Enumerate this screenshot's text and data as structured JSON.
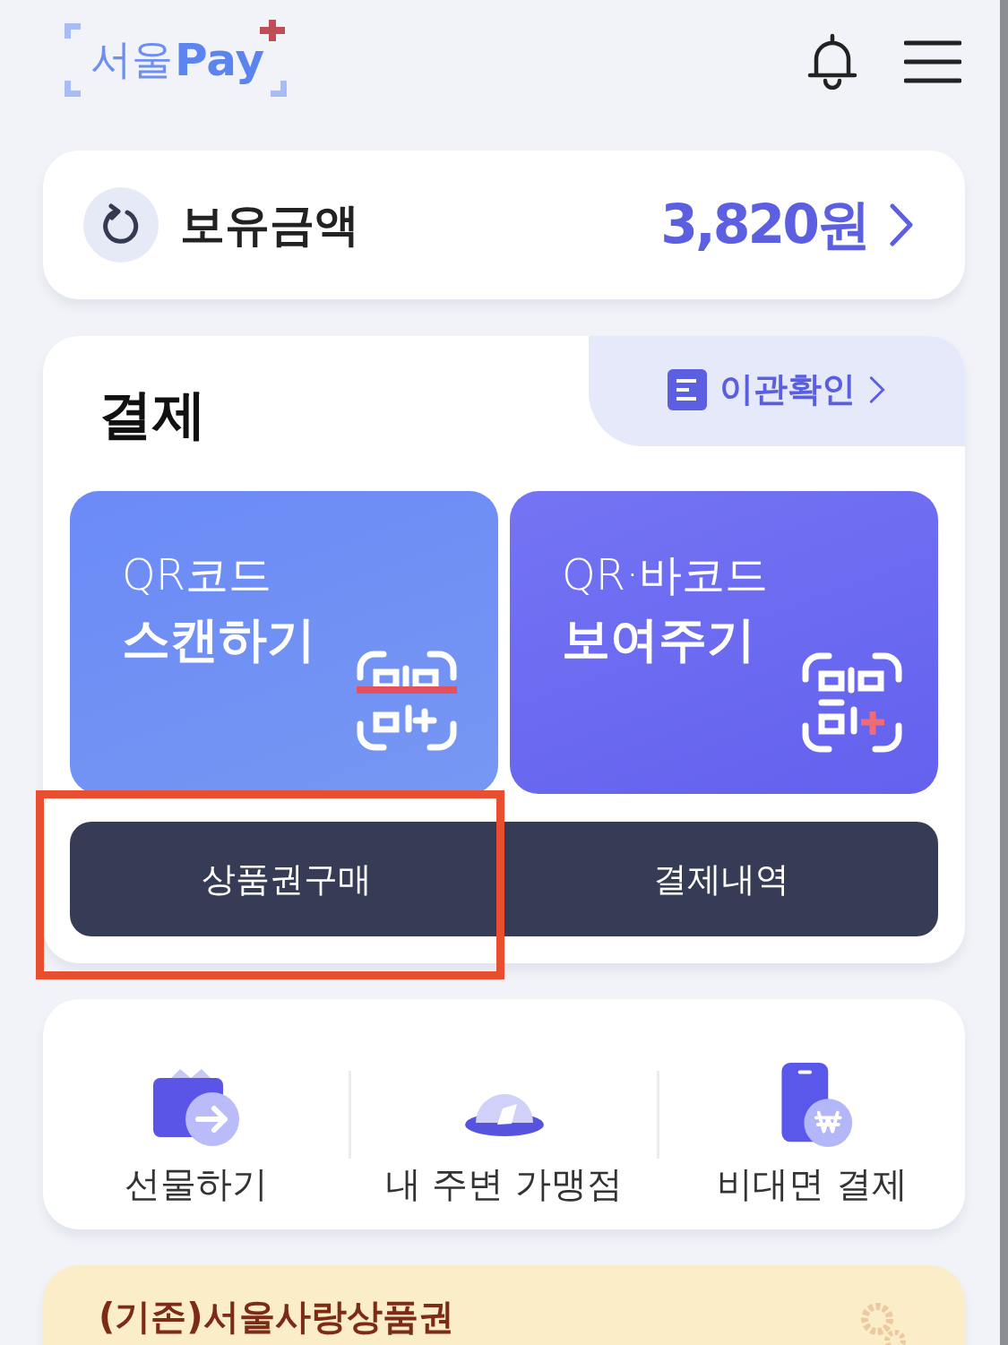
{
  "header": {
    "logo_korean": "서울",
    "logo_latin": "Pay"
  },
  "balance": {
    "label": "보유금액",
    "amount": "3,820원"
  },
  "payment": {
    "title": "결제",
    "transfer_link": "이관확인",
    "tiles": [
      {
        "kind": "scan",
        "line1": "QR코드",
        "line2": "스캔하기"
      },
      {
        "kind": "show",
        "line1": "QR·바코드",
        "line2": "보여주기"
      }
    ],
    "buttons": [
      {
        "label": "상품권구매",
        "highlighted": true
      },
      {
        "label": "결제내역",
        "highlighted": false
      }
    ]
  },
  "shortcuts": [
    {
      "kind": "gift",
      "label": "선물하기"
    },
    {
      "kind": "nearby",
      "label": "내 주변 가맹점"
    },
    {
      "kind": "contactless",
      "label": "비대면 결제"
    }
  ],
  "promo": {
    "title": "(기존)서울사랑상품권"
  }
}
